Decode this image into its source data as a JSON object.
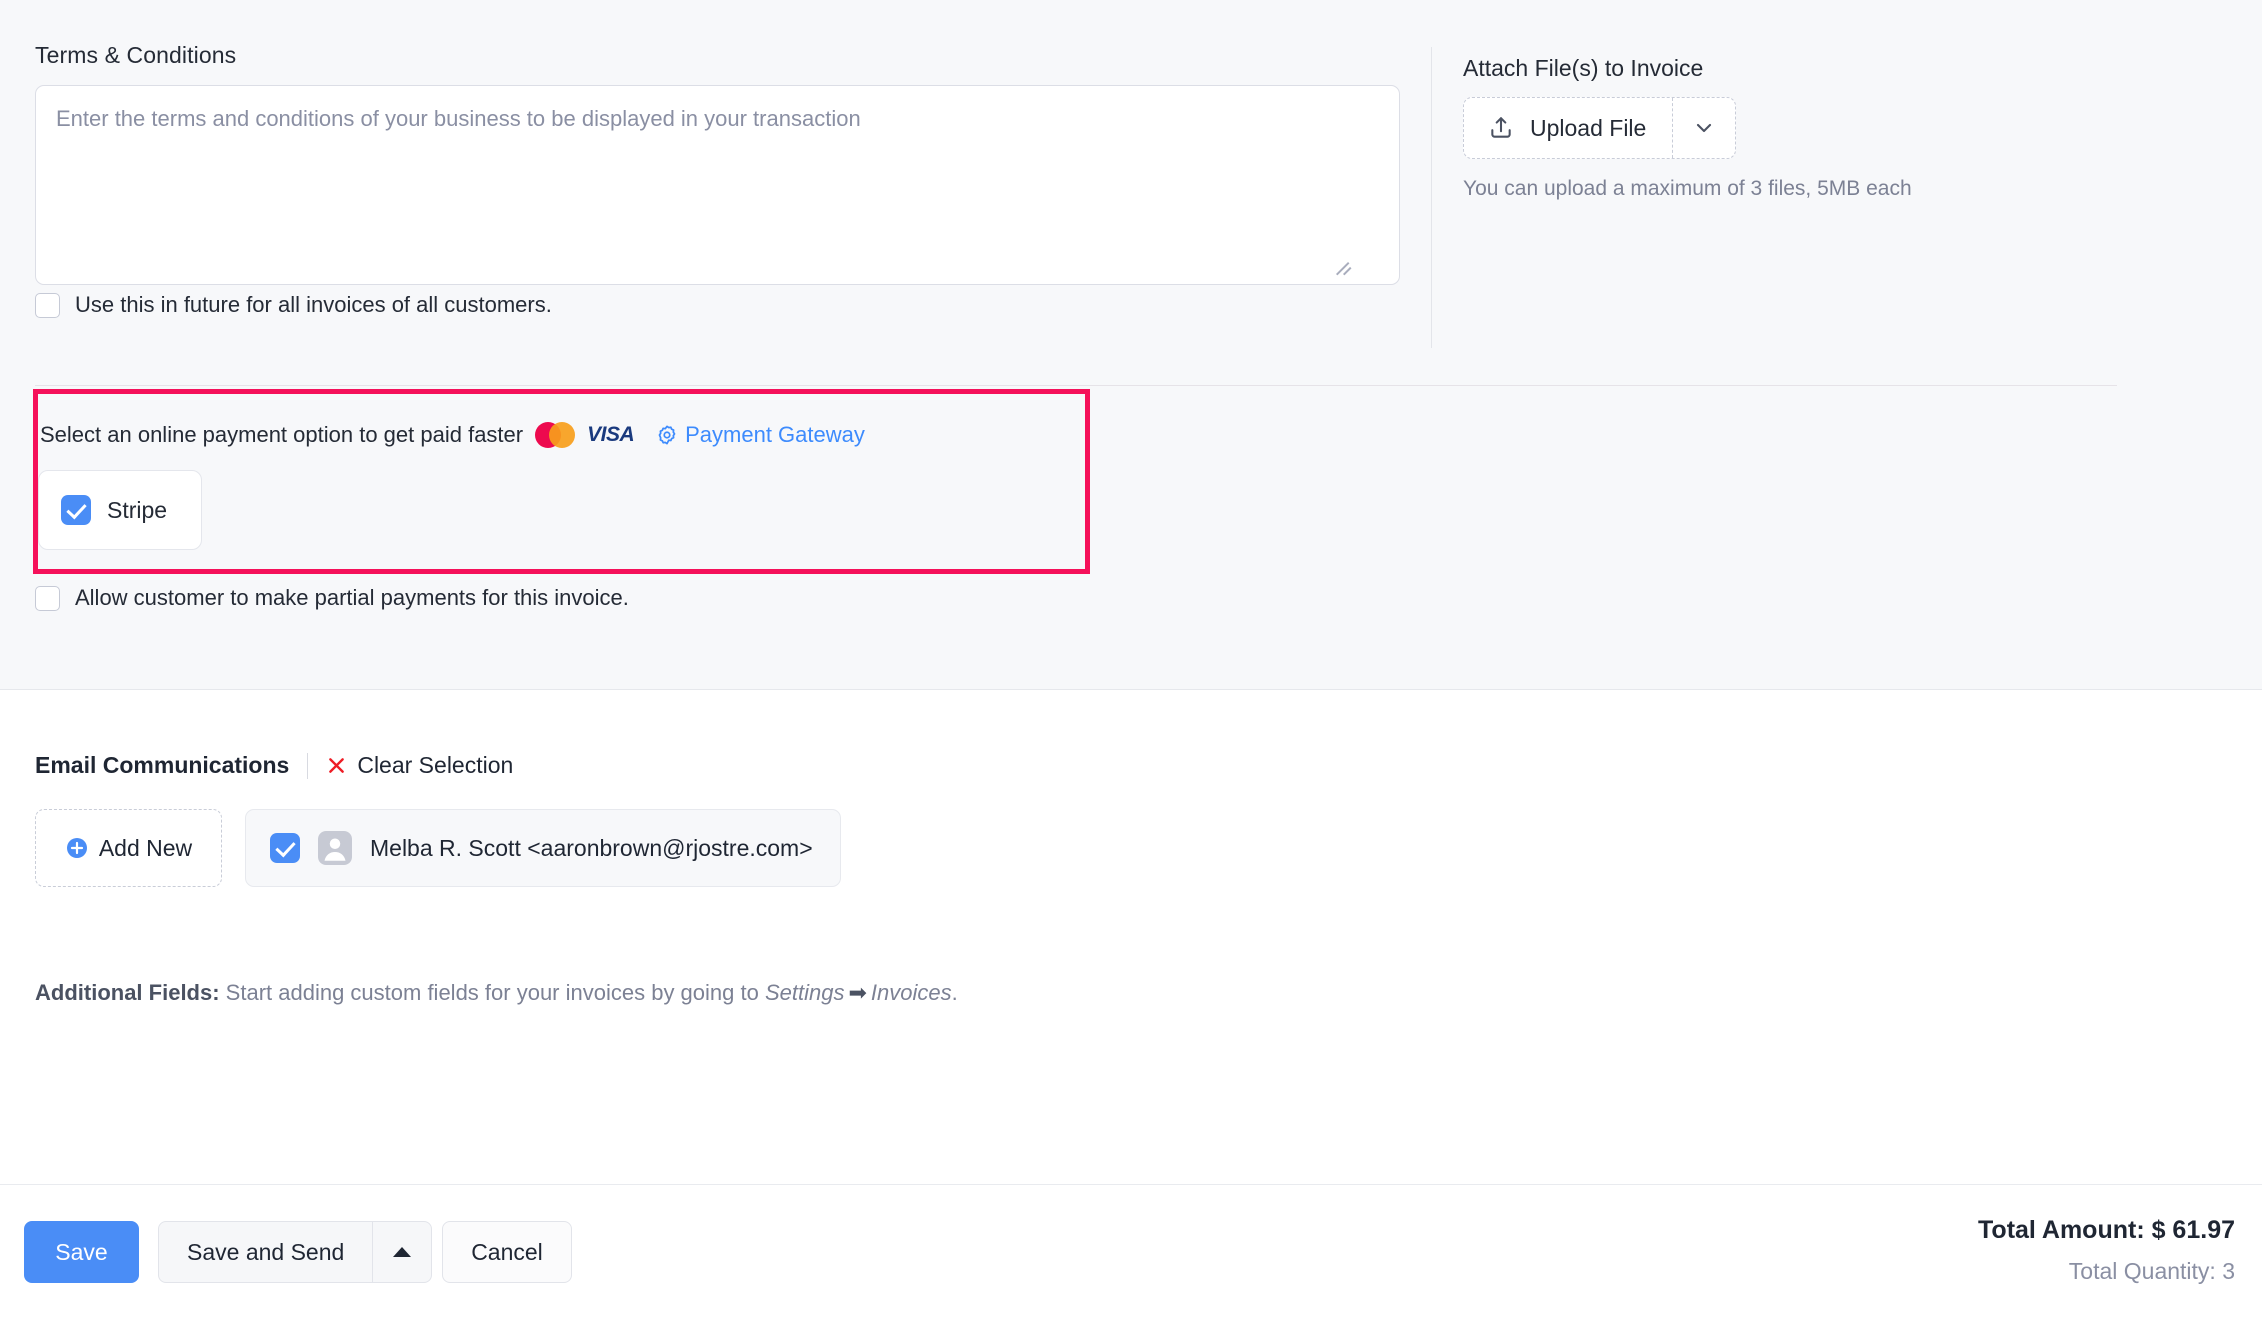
{
  "terms": {
    "label": "Terms & Conditions",
    "placeholder": "Enter the terms and conditions of your business to be displayed in your transaction",
    "value": "",
    "reuse_checkbox_label": "Use this in future for all invoices of all customers.",
    "reuse_checked": false
  },
  "attach": {
    "label": "Attach File(s) to Invoice",
    "upload_button_label": "Upload File",
    "upload_icon": "upload-icon",
    "caret_icon": "chevron-down-icon",
    "hint": "You can upload a maximum of 3 files, 5MB each"
  },
  "payment": {
    "prompt": "Select an online payment option to get paid faster",
    "card_logos": [
      "mastercard-logo",
      "visa-logo"
    ],
    "visa_text": "VISA",
    "gateway_link_label": "Payment Gateway",
    "gateway_icon": "gear-icon",
    "gateway_link_color": "#3d8bfd",
    "highlight_color": "#f5115a",
    "options": [
      {
        "label": "Stripe",
        "checked": true
      }
    ],
    "partial_checkbox_label": "Allow customer to make partial payments for this invoice.",
    "partial_checked": false
  },
  "email": {
    "title": "Email Communications",
    "clear_selection_label": "Clear Selection",
    "clear_icon": "close-x-icon",
    "add_new_label": "Add New",
    "add_new_icon": "plus-circle-icon",
    "recipients": [
      {
        "label": "Melba R. Scott <aaronbrown@rjostre.com>",
        "checked": true,
        "avatar_icon": "user-avatar-icon"
      }
    ]
  },
  "additional_fields": {
    "prefix": "Additional Fields:",
    "text_before": " Start adding custom fields for your invoices by going to ",
    "link_settings": "Settings",
    "arrow": "➡",
    "link_invoices": "Invoices",
    "suffix": "."
  },
  "toolbar": {
    "save_label": "Save",
    "save_and_send_label": "Save and Send",
    "save_and_send_caret": "caret-up-icon",
    "cancel_label": "Cancel",
    "total_amount": "Total Amount: $ 61.97",
    "total_quantity": "Total Quantity: 3",
    "primary_color": "#4a8df6"
  }
}
